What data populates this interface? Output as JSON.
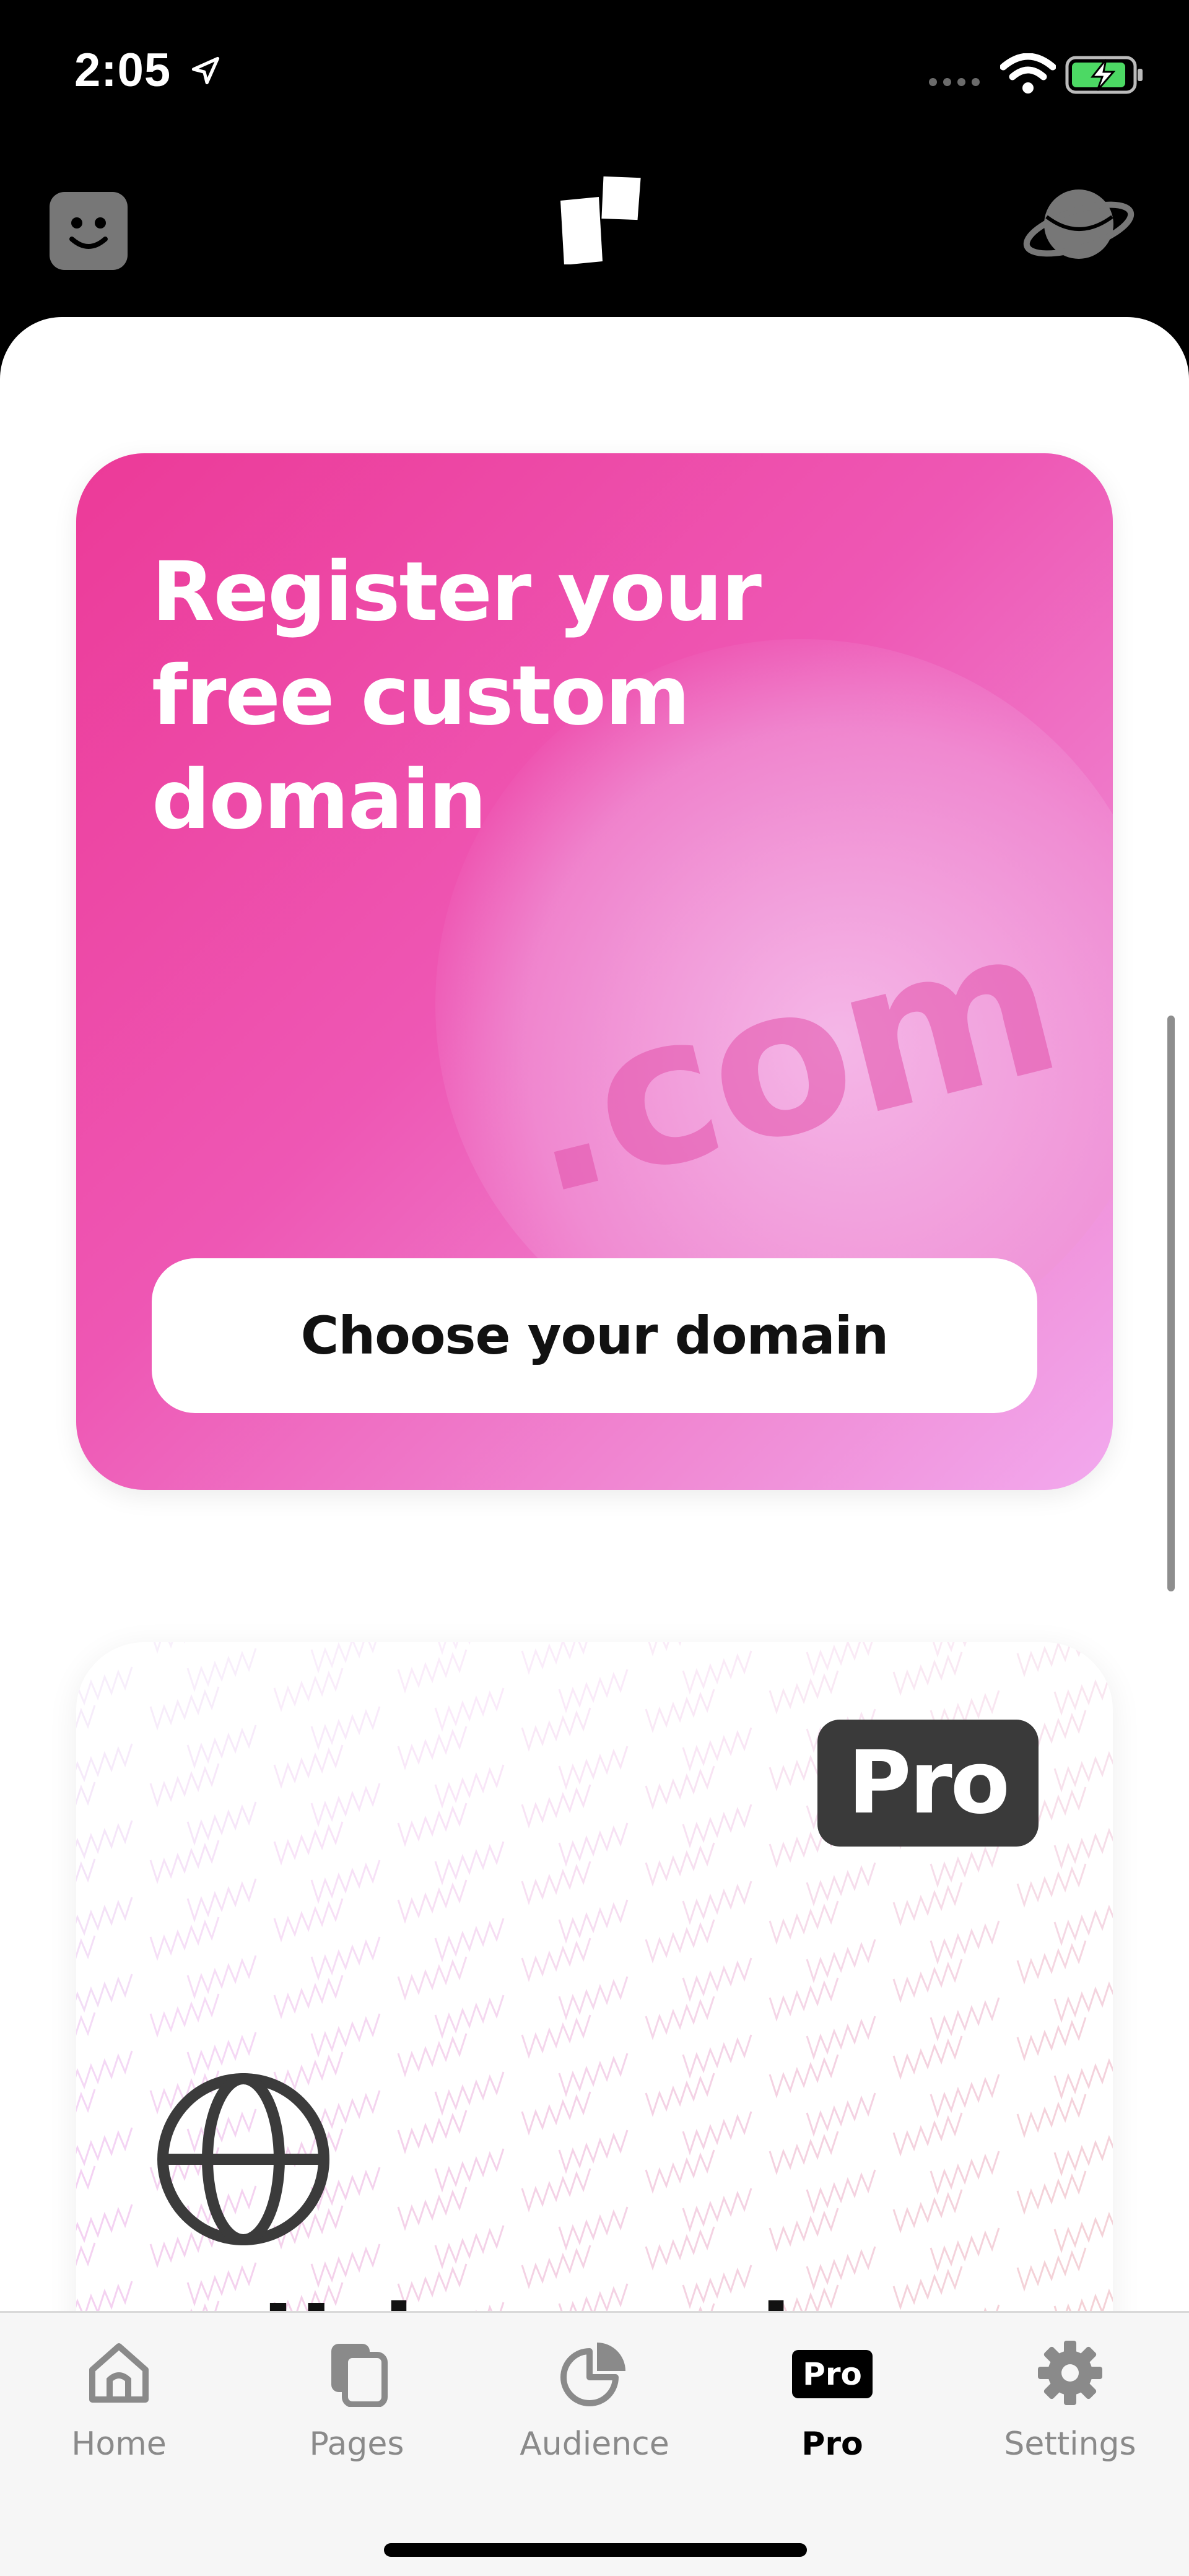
{
  "status_bar": {
    "time": "2:05"
  },
  "promo": {
    "title": "Register your free custom domain",
    "decoration_text": ".com",
    "button_label": "Choose your domain",
    "gradient_start": "#ec3a98",
    "gradient_end": "#f2a9ee"
  },
  "pro_card": {
    "badge": "Pro",
    "title": "Using a primary"
  },
  "tabs": [
    {
      "label": "Home",
      "icon": "home-icon"
    },
    {
      "label": "Pages",
      "icon": "pages-icon"
    },
    {
      "label": "Audience",
      "icon": "pie-chart-icon"
    },
    {
      "label": "Pro",
      "icon": "pro-badge-icon",
      "badge": "Pro",
      "active": true
    },
    {
      "label": "Settings",
      "icon": "gear-icon"
    }
  ],
  "colors": {
    "accent": "#ec3a98",
    "tab_inactive": "#8a8a8a",
    "tab_active": "#000000"
  }
}
